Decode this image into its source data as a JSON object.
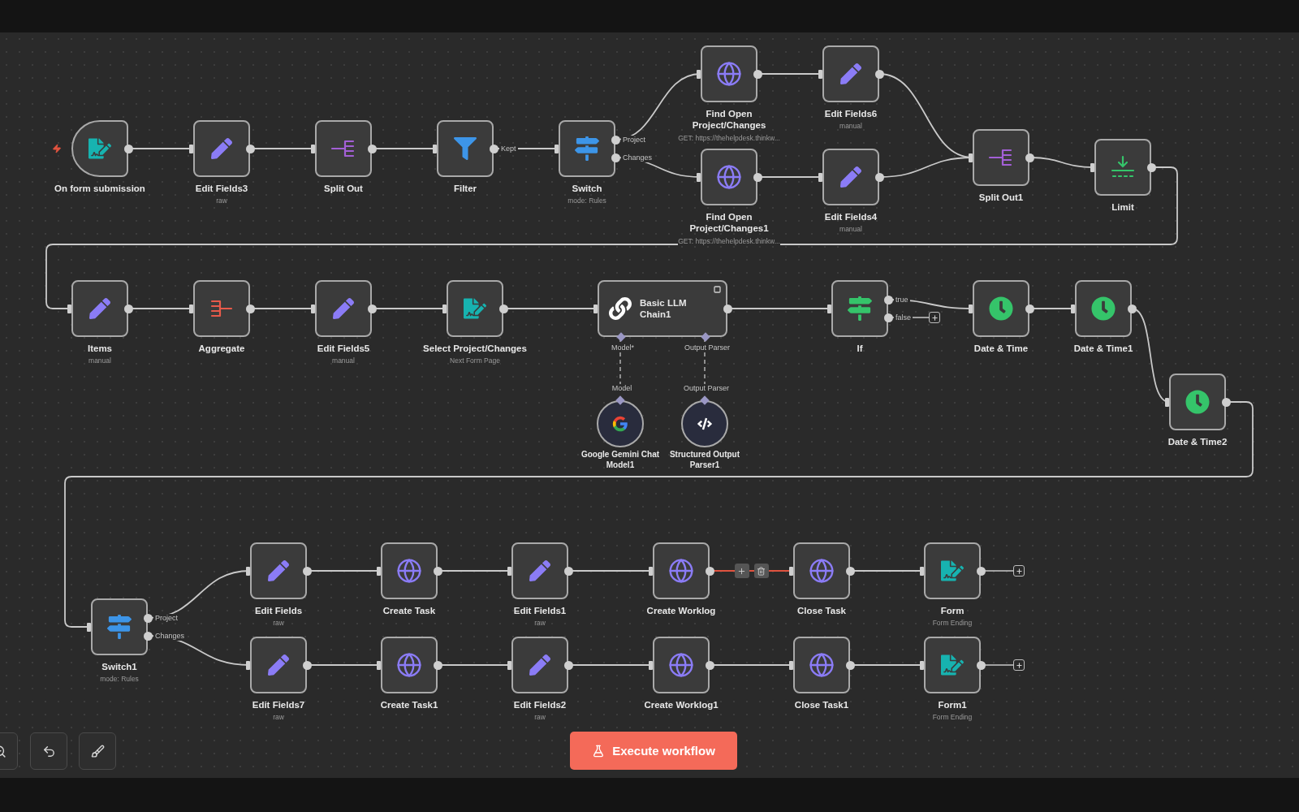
{
  "nodes": [
    {
      "name": "On form submission",
      "kind": "trigger"
    },
    {
      "name": "Edit Fields3",
      "subtitle": "raw",
      "kind": "action"
    },
    {
      "name": "Split Out",
      "kind": "action"
    },
    {
      "name": "Filter",
      "kind": "action",
      "outputs": [
        "Kept"
      ]
    },
    {
      "name": "Switch",
      "subtitle": "mode: Rules",
      "kind": "action",
      "outputs": [
        "Project",
        "Changes"
      ]
    },
    {
      "name": "Find Open Project/Changes",
      "subtitle": "GET: https://thehelpdesk.thinkw...",
      "kind": "action"
    },
    {
      "name": "Edit Fields6",
      "subtitle": "manual",
      "kind": "action"
    },
    {
      "name": "Find Open Project/Changes1",
      "subtitle": "GET: https://thehelpdesk.thinkw...",
      "kind": "action"
    },
    {
      "name": "Edit Fields4",
      "subtitle": "manual",
      "kind": "action"
    },
    {
      "name": "Split Out1",
      "kind": "action"
    },
    {
      "name": "Limit",
      "kind": "action"
    },
    {
      "name": "Items",
      "subtitle": "manual",
      "kind": "action"
    },
    {
      "name": "Aggregate",
      "kind": "action"
    },
    {
      "name": "Edit Fields5",
      "subtitle": "manual",
      "kind": "action"
    },
    {
      "name": "Select Project/Changes",
      "subtitle": "Next Form Page",
      "kind": "action"
    },
    {
      "name": "Basic LLM Chain1",
      "kind": "chain",
      "inputs": [
        "Model*",
        "Output Parser"
      ]
    },
    {
      "name": "If",
      "kind": "action",
      "outputs": [
        "true",
        "false"
      ]
    },
    {
      "name": "Date & Time",
      "kind": "action"
    },
    {
      "name": "Date & Time1",
      "kind": "action"
    },
    {
      "name": "Google Gemini Chat Model1",
      "kind": "sub",
      "output_label": "Model"
    },
    {
      "name": "Structured Output Parser1",
      "kind": "sub",
      "output_label": "Output Parser"
    },
    {
      "name": "Date & Time2",
      "kind": "action"
    },
    {
      "name": "Switch1",
      "subtitle": "mode: Rules",
      "kind": "action",
      "outputs": [
        "Project",
        "Changes"
      ]
    },
    {
      "name": "Edit Fields",
      "subtitle": "raw",
      "kind": "action"
    },
    {
      "name": "Create Task",
      "kind": "action"
    },
    {
      "name": "Edit Fields1",
      "subtitle": "raw",
      "kind": "action"
    },
    {
      "name": "Create Worklog",
      "kind": "action",
      "hovered_output": true
    },
    {
      "name": "Close Task",
      "kind": "action"
    },
    {
      "name": "Form",
      "subtitle": "Form Ending",
      "kind": "action"
    },
    {
      "name": "Edit Fields7",
      "subtitle": "raw",
      "kind": "action"
    },
    {
      "name": "Create Task1",
      "kind": "action"
    },
    {
      "name": "Edit Fields2",
      "subtitle": "raw",
      "kind": "action"
    },
    {
      "name": "Create Worklog1",
      "kind": "action"
    },
    {
      "name": "Close Task1",
      "kind": "action"
    },
    {
      "name": "Form1",
      "subtitle": "Form Ending",
      "kind": "action"
    }
  ],
  "execute_button": "Execute workflow"
}
